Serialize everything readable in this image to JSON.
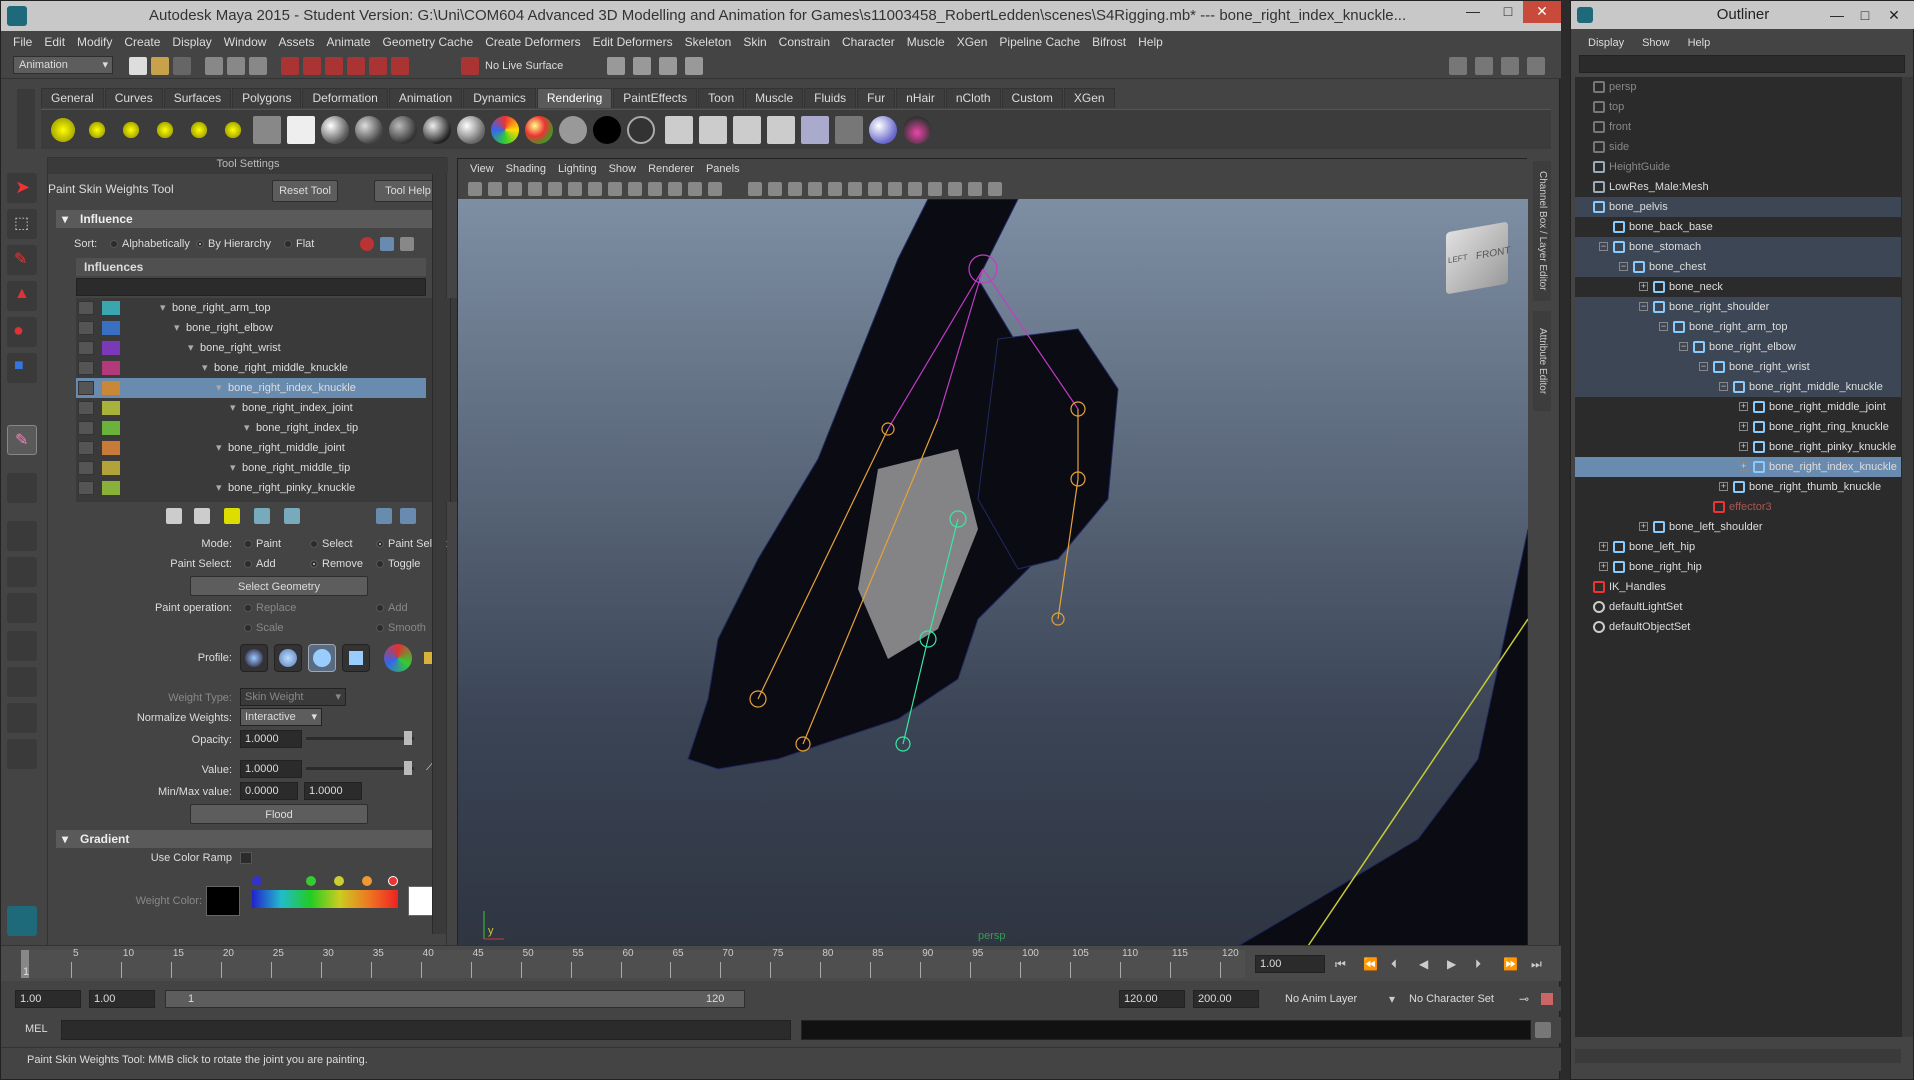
{
  "window": {
    "title": "Autodesk Maya 2015 - Student Version: G:\\Uni\\COM604 Advanced 3D Modelling and Animation for Games\\s11003458_RobertLedden\\scenes\\S4Rigging.mb*   ---   bone_right_index_knuckle...",
    "minimize": "—",
    "maximize": "□",
    "close": "✕"
  },
  "menubar": [
    "File",
    "Edit",
    "Modify",
    "Create",
    "Display",
    "Window",
    "Assets",
    "Animate",
    "Geometry Cache",
    "Create Deformers",
    "Edit Deformers",
    "Skeleton",
    "Skin",
    "Constrain",
    "Character",
    "Muscle",
    "XGen",
    "Pipeline Cache",
    "Bifrost",
    "Help"
  ],
  "statusline": {
    "menuset": "Animation",
    "live_surface": "No Live Surface"
  },
  "shelf_tabs": [
    "General",
    "Curves",
    "Surfaces",
    "Polygons",
    "Deformation",
    "Animation",
    "Dynamics",
    "Rendering",
    "PaintEffects",
    "Toon",
    "Muscle",
    "Fluids",
    "Fur",
    "nHair",
    "nCloth",
    "Custom",
    "XGen"
  ],
  "shelf_active": "Rendering",
  "tool_settings": {
    "header": "Tool Settings",
    "tool_name": "Paint Skin Weights Tool",
    "reset_tool": "Reset Tool",
    "tool_help": "Tool Help",
    "influence_section": "Influence",
    "sort_label": "Sort:",
    "sort_options": [
      "Alphabetically",
      "By Hierarchy",
      "Flat"
    ],
    "influences_header": "Influences",
    "influences": [
      {
        "name": "bone_right_arm_top",
        "color": "#3aa6b0",
        "indent": 0
      },
      {
        "name": "bone_right_elbow",
        "color": "#3a6fc2",
        "indent": 1
      },
      {
        "name": "bone_right_wrist",
        "color": "#7a3ab8",
        "indent": 2
      },
      {
        "name": "bone_right_middle_knuckle",
        "color": "#b23a7a",
        "indent": 3
      },
      {
        "name": "bone_right_index_knuckle",
        "color": "#c88838",
        "indent": 4,
        "selected": true
      },
      {
        "name": "bone_right_index_joint",
        "color": "#a8b23a",
        "indent": 5
      },
      {
        "name": "bone_right_index_tip",
        "color": "#6ab23a",
        "indent": 6
      },
      {
        "name": "bone_right_middle_joint",
        "color": "#c87a38",
        "indent": 4
      },
      {
        "name": "bone_right_middle_tip",
        "color": "#b2a23a",
        "indent": 5
      },
      {
        "name": "bone_right_pinky_knuckle",
        "color": "#8ab23a",
        "indent": 4
      }
    ],
    "mode_label": "Mode:",
    "mode_options": [
      "Paint",
      "Select",
      "Paint Select"
    ],
    "paint_select_label": "Paint Select:",
    "paint_select_options": [
      "Add",
      "Remove",
      "Toggle"
    ],
    "select_geometry": "Select Geometry",
    "paint_operation_label": "Paint operation:",
    "paint_operations": [
      "Replace",
      "Add",
      "Scale",
      "Smooth"
    ],
    "profile_label": "Profile:",
    "weight_type_label": "Weight Type:",
    "weight_type_value": "Skin Weight",
    "normalize_label": "Normalize Weights:",
    "normalize_value": "Interactive",
    "opacity_label": "Opacity:",
    "opacity_value": "1.0000",
    "value_label": "Value:",
    "value_value": "1.0000",
    "minmax_label": "Min/Max value:",
    "min_value": "0.0000",
    "max_value": "1.0000",
    "flood": "Flood",
    "gradient_section": "Gradient",
    "use_color_ramp": "Use Color Ramp",
    "weight_color_label": "Weight Color:"
  },
  "viewport": {
    "menus": [
      "View",
      "Shading",
      "Lighting",
      "Show",
      "Renderer",
      "Panels"
    ],
    "camera_label": "persp",
    "viewcube_face": "FRONT",
    "viewcube_side": "LEFT",
    "axis_y": "y",
    "side_tabs": [
      "Channel Box / Layer Editor",
      "Attribute Editor"
    ]
  },
  "timeline": {
    "ticks": [
      "5",
      "10",
      "15",
      "20",
      "25",
      "30",
      "35",
      "40",
      "45",
      "50",
      "55",
      "60",
      "65",
      "70",
      "75",
      "80",
      "85",
      "90",
      "95",
      "100",
      "105",
      "110",
      "115",
      "120"
    ],
    "current_frame": "1.00",
    "current_marker": "1"
  },
  "range": {
    "start": "1.00",
    "anim_start": "1.00",
    "slider_start": "1",
    "slider_end": "120",
    "anim_end": "120.00",
    "end": "200.00",
    "anim_layer": "No Anim Layer",
    "character_set": "No Character Set"
  },
  "mel": {
    "label": "MEL"
  },
  "help_line": "Paint Skin Weights Tool: MMB click to rotate the joint you are painting.",
  "outliner": {
    "title": "Outliner",
    "menus": [
      "Display",
      "Show",
      "Help"
    ],
    "items": [
      {
        "name": "persp",
        "depth": 0,
        "type": "camera",
        "dim": true
      },
      {
        "name": "top",
        "depth": 0,
        "type": "camera",
        "dim": true
      },
      {
        "name": "front",
        "depth": 0,
        "type": "camera",
        "dim": true
      },
      {
        "name": "side",
        "depth": 0,
        "type": "camera",
        "dim": true
      },
      {
        "name": "HeightGuide",
        "depth": 0,
        "type": "mesh",
        "dim": true
      },
      {
        "name": "LowRes_Male:Mesh",
        "depth": 0,
        "type": "mesh"
      },
      {
        "name": "bone_pelvis",
        "depth": 0,
        "type": "joint",
        "hl": true
      },
      {
        "name": "bone_back_base",
        "depth": 1,
        "type": "joint"
      },
      {
        "name": "bone_stomach",
        "depth": 1,
        "type": "joint",
        "exp": "−",
        "hl": true
      },
      {
        "name": "bone_chest",
        "depth": 2,
        "type": "joint",
        "exp": "−",
        "hl": true
      },
      {
        "name": "bone_neck",
        "depth": 3,
        "type": "joint",
        "exp": "+"
      },
      {
        "name": "bone_right_shoulder",
        "depth": 3,
        "type": "joint",
        "exp": "−",
        "hl": true
      },
      {
        "name": "bone_right_arm_top",
        "depth": 4,
        "type": "joint",
        "exp": "−",
        "hl": true
      },
      {
        "name": "bone_right_elbow",
        "depth": 5,
        "type": "joint",
        "exp": "−",
        "hl": true
      },
      {
        "name": "bone_right_wrist",
        "depth": 6,
        "type": "joint",
        "exp": "−",
        "hl": true
      },
      {
        "name": "bone_right_middle_knuckle",
        "depth": 7,
        "type": "joint",
        "exp": "−",
        "hl": true
      },
      {
        "name": "bone_right_middle_joint",
        "depth": 8,
        "type": "joint",
        "exp": "+"
      },
      {
        "name": "bone_right_ring_knuckle",
        "depth": 8,
        "type": "joint",
        "exp": "+"
      },
      {
        "name": "bone_right_pinky_knuckle",
        "depth": 8,
        "type": "joint",
        "exp": "+"
      },
      {
        "name": "bone_right_index_knuckle",
        "depth": 8,
        "type": "joint",
        "exp": "+",
        "sel": true
      },
      {
        "name": "bone_right_thumb_knuckle",
        "depth": 7,
        "type": "joint",
        "exp": "+"
      },
      {
        "name": "effector3",
        "depth": 6,
        "type": "effector",
        "dim": true
      },
      {
        "name": "bone_left_shoulder",
        "depth": 3,
        "type": "joint",
        "exp": "+"
      },
      {
        "name": "bone_left_hip",
        "depth": 1,
        "type": "joint",
        "exp": "+"
      },
      {
        "name": "bone_right_hip",
        "depth": 1,
        "type": "joint",
        "exp": "+"
      },
      {
        "name": "IK_Handles",
        "depth": 0,
        "type": "ik"
      },
      {
        "name": "defaultLightSet",
        "depth": 0,
        "type": "set"
      },
      {
        "name": "defaultObjectSet",
        "depth": 0,
        "type": "set"
      }
    ]
  }
}
